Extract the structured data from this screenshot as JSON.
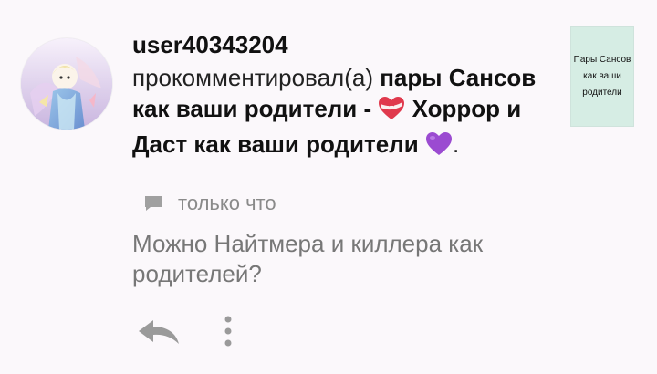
{
  "notification": {
    "username": "user40343204",
    "action": "прокомментировал(а)",
    "post_title_part1": "пары Сансов как ваши родители -",
    "post_title_part2": "Хоррор и Даст как ваши родители",
    "trailing": ".",
    "thumbnail_text": "Пары Сансов как ваши родители"
  },
  "meta": {
    "time": "только что"
  },
  "comment": {
    "text": "Можно Найтмера и киллера как родителей?"
  },
  "icons": {
    "comment": "speech-bubble-icon",
    "reply": "reply-arrow-icon",
    "more": "vertical-dots-icon",
    "heart": "heart-ribbon-emoji",
    "purple_heart": "purple-heart-emoji"
  },
  "colors": {
    "background": "#fbf8fb",
    "text_primary": "#111111",
    "text_secondary": "#777777",
    "icon_gray": "#a0a0a0",
    "thumb_bg": "#d6ede4",
    "heart_red": "#e0394d",
    "heart_purple": "#9b4bd1"
  }
}
